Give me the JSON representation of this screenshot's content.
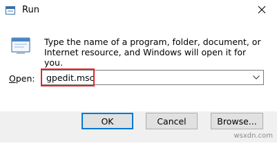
{
  "window": {
    "title": "Run",
    "close_glyph": "✕"
  },
  "dialog": {
    "description": "Type the name of a program, folder, document, or Internet resource, and Windows will open it for you.",
    "open_label_prefix": "O",
    "open_label_rest": "pen:",
    "open_value": "gpedit.msc",
    "dropdown_glyph": "⌄"
  },
  "buttons": {
    "ok": "OK",
    "cancel": "Cancel",
    "browse": "Browse..."
  },
  "watermark": "wsxdn.com",
  "colors": {
    "highlight": "#e0262b",
    "ok_border": "#0078d7",
    "footer_bg": "#f0f0f0"
  },
  "icons": [
    "run-app-icon",
    "close-icon",
    "run-dialog-icon",
    "dropdown-arrow-icon"
  ]
}
